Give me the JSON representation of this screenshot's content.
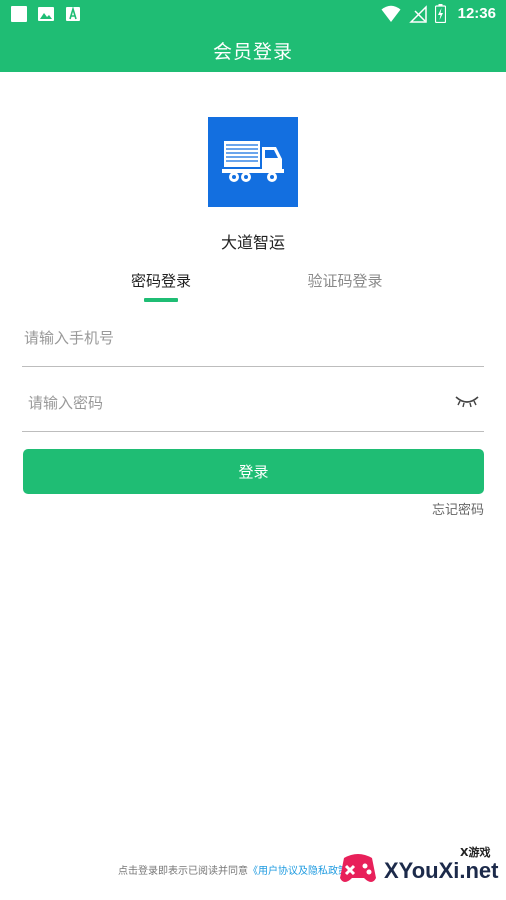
{
  "status_bar": {
    "time": "12:36",
    "left_icons": [
      "square-notification-icon",
      "image-icon",
      "text-a-icon"
    ],
    "right_icons": [
      "wifi-icon",
      "no-signal-icon",
      "battery-charging-icon"
    ]
  },
  "header": {
    "title": "会员登录"
  },
  "brand": {
    "app_name": "大道智运",
    "logo_icon": "truck-icon",
    "logo_color": "#136fe0"
  },
  "tabs": [
    {
      "label": "密码登录",
      "active": true
    },
    {
      "label": "验证码登录",
      "active": false
    }
  ],
  "form": {
    "phone": {
      "placeholder": "请输入手机号",
      "value": ""
    },
    "password": {
      "placeholder": "请输入密码",
      "value": ""
    },
    "toggle_icon": "eye-closed-icon",
    "submit_label": "登录",
    "forgot_label": "忘记密码"
  },
  "footer": {
    "agreement_text": "点击登录即表示已阅读并同意",
    "agreement_link": "《用户协议及隐私政策》"
  },
  "watermark": {
    "tag": "X游戏",
    "text": "XYouXi.net"
  },
  "colors": {
    "accent": "#1fbd74",
    "link": "#1f9be0",
    "logo_bg": "#136fe0"
  }
}
